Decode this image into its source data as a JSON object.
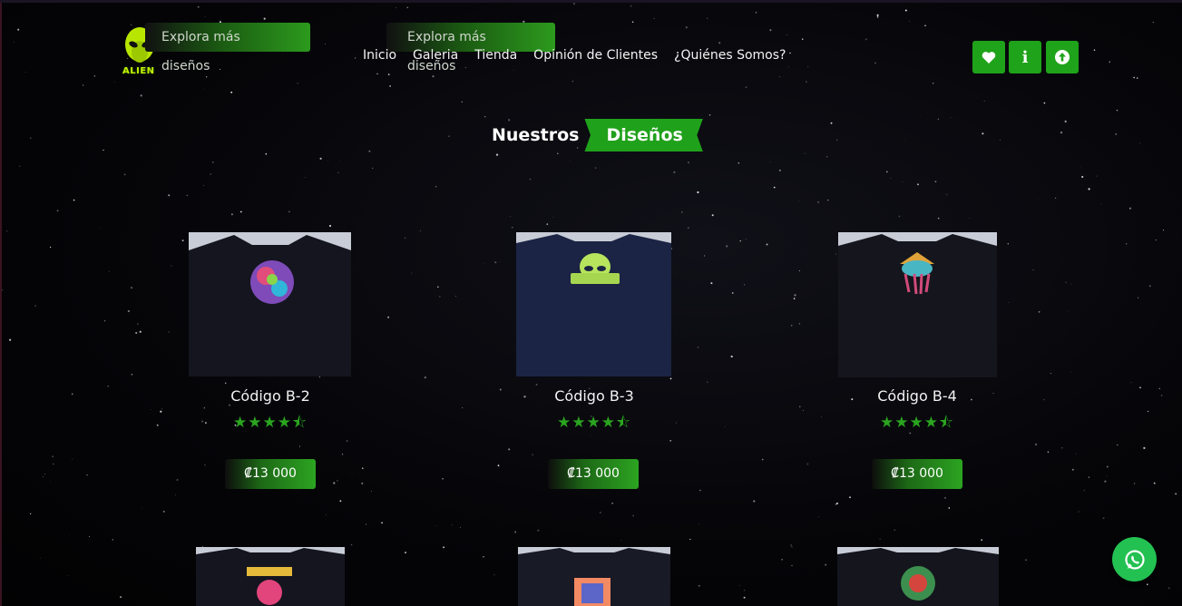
{
  "brand": {
    "logo_text": "ALIEN"
  },
  "header": {
    "explore_label_1": "Explora más diseños",
    "explore_label_2": "Explora más diseños",
    "nav": [
      "Inicio",
      "Galeria",
      "Tienda",
      "Opinión de Clientes",
      "¿Quiénes Somos?"
    ],
    "icons": [
      "heart-icon",
      "info-icon",
      "arrow-up-icon"
    ],
    "info_glyph": "i"
  },
  "section": {
    "title_plain": "Nuestros",
    "title_highlight": "Diseños"
  },
  "products": [
    {
      "title": "Código B-2",
      "price": "₡13 000",
      "rating": 4.5,
      "stars": "★★★★⯪"
    },
    {
      "title": "Código B-3",
      "price": "₡13 000",
      "rating": 4.5,
      "stars": "★★★★⯪"
    },
    {
      "title": "Código B-4",
      "price": "₡13 000",
      "rating": 4.5,
      "stars": "★★★★⯪"
    }
  ],
  "colors": {
    "accent": "#20a11b",
    "whatsapp": "#23c152",
    "logo": "#c6f000"
  }
}
